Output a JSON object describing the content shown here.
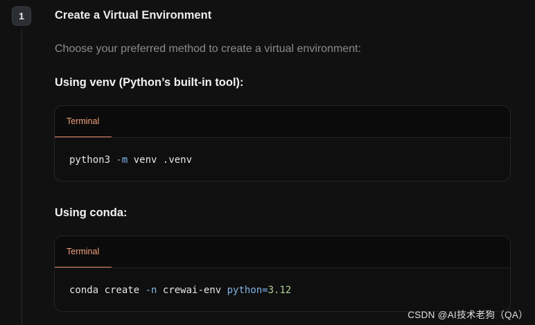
{
  "step": {
    "number": "1",
    "title": "Create a Virtual Environment"
  },
  "description": "Choose your preferred method to create a virtual environment:",
  "sections": [
    {
      "heading": "Using venv (Python’s built-in tool):",
      "tab_label": "Terminal",
      "code": {
        "cmd": "python3",
        "flag": "-m",
        "rest": "venv .venv"
      }
    },
    {
      "heading": "Using conda:",
      "tab_label": "Terminal",
      "code": {
        "cmd": "conda create",
        "flag": "-n",
        "arg": "crewai-env",
        "builtin": "python",
        "op": "=",
        "num": "3.12"
      }
    }
  ],
  "watermark": "CSDN @AI技术老狗（QA）",
  "colors": {
    "background": "#111111",
    "tab_accent": "#e8896a",
    "code_keyword": "#7fb6e8",
    "code_number": "#b3d39a"
  }
}
